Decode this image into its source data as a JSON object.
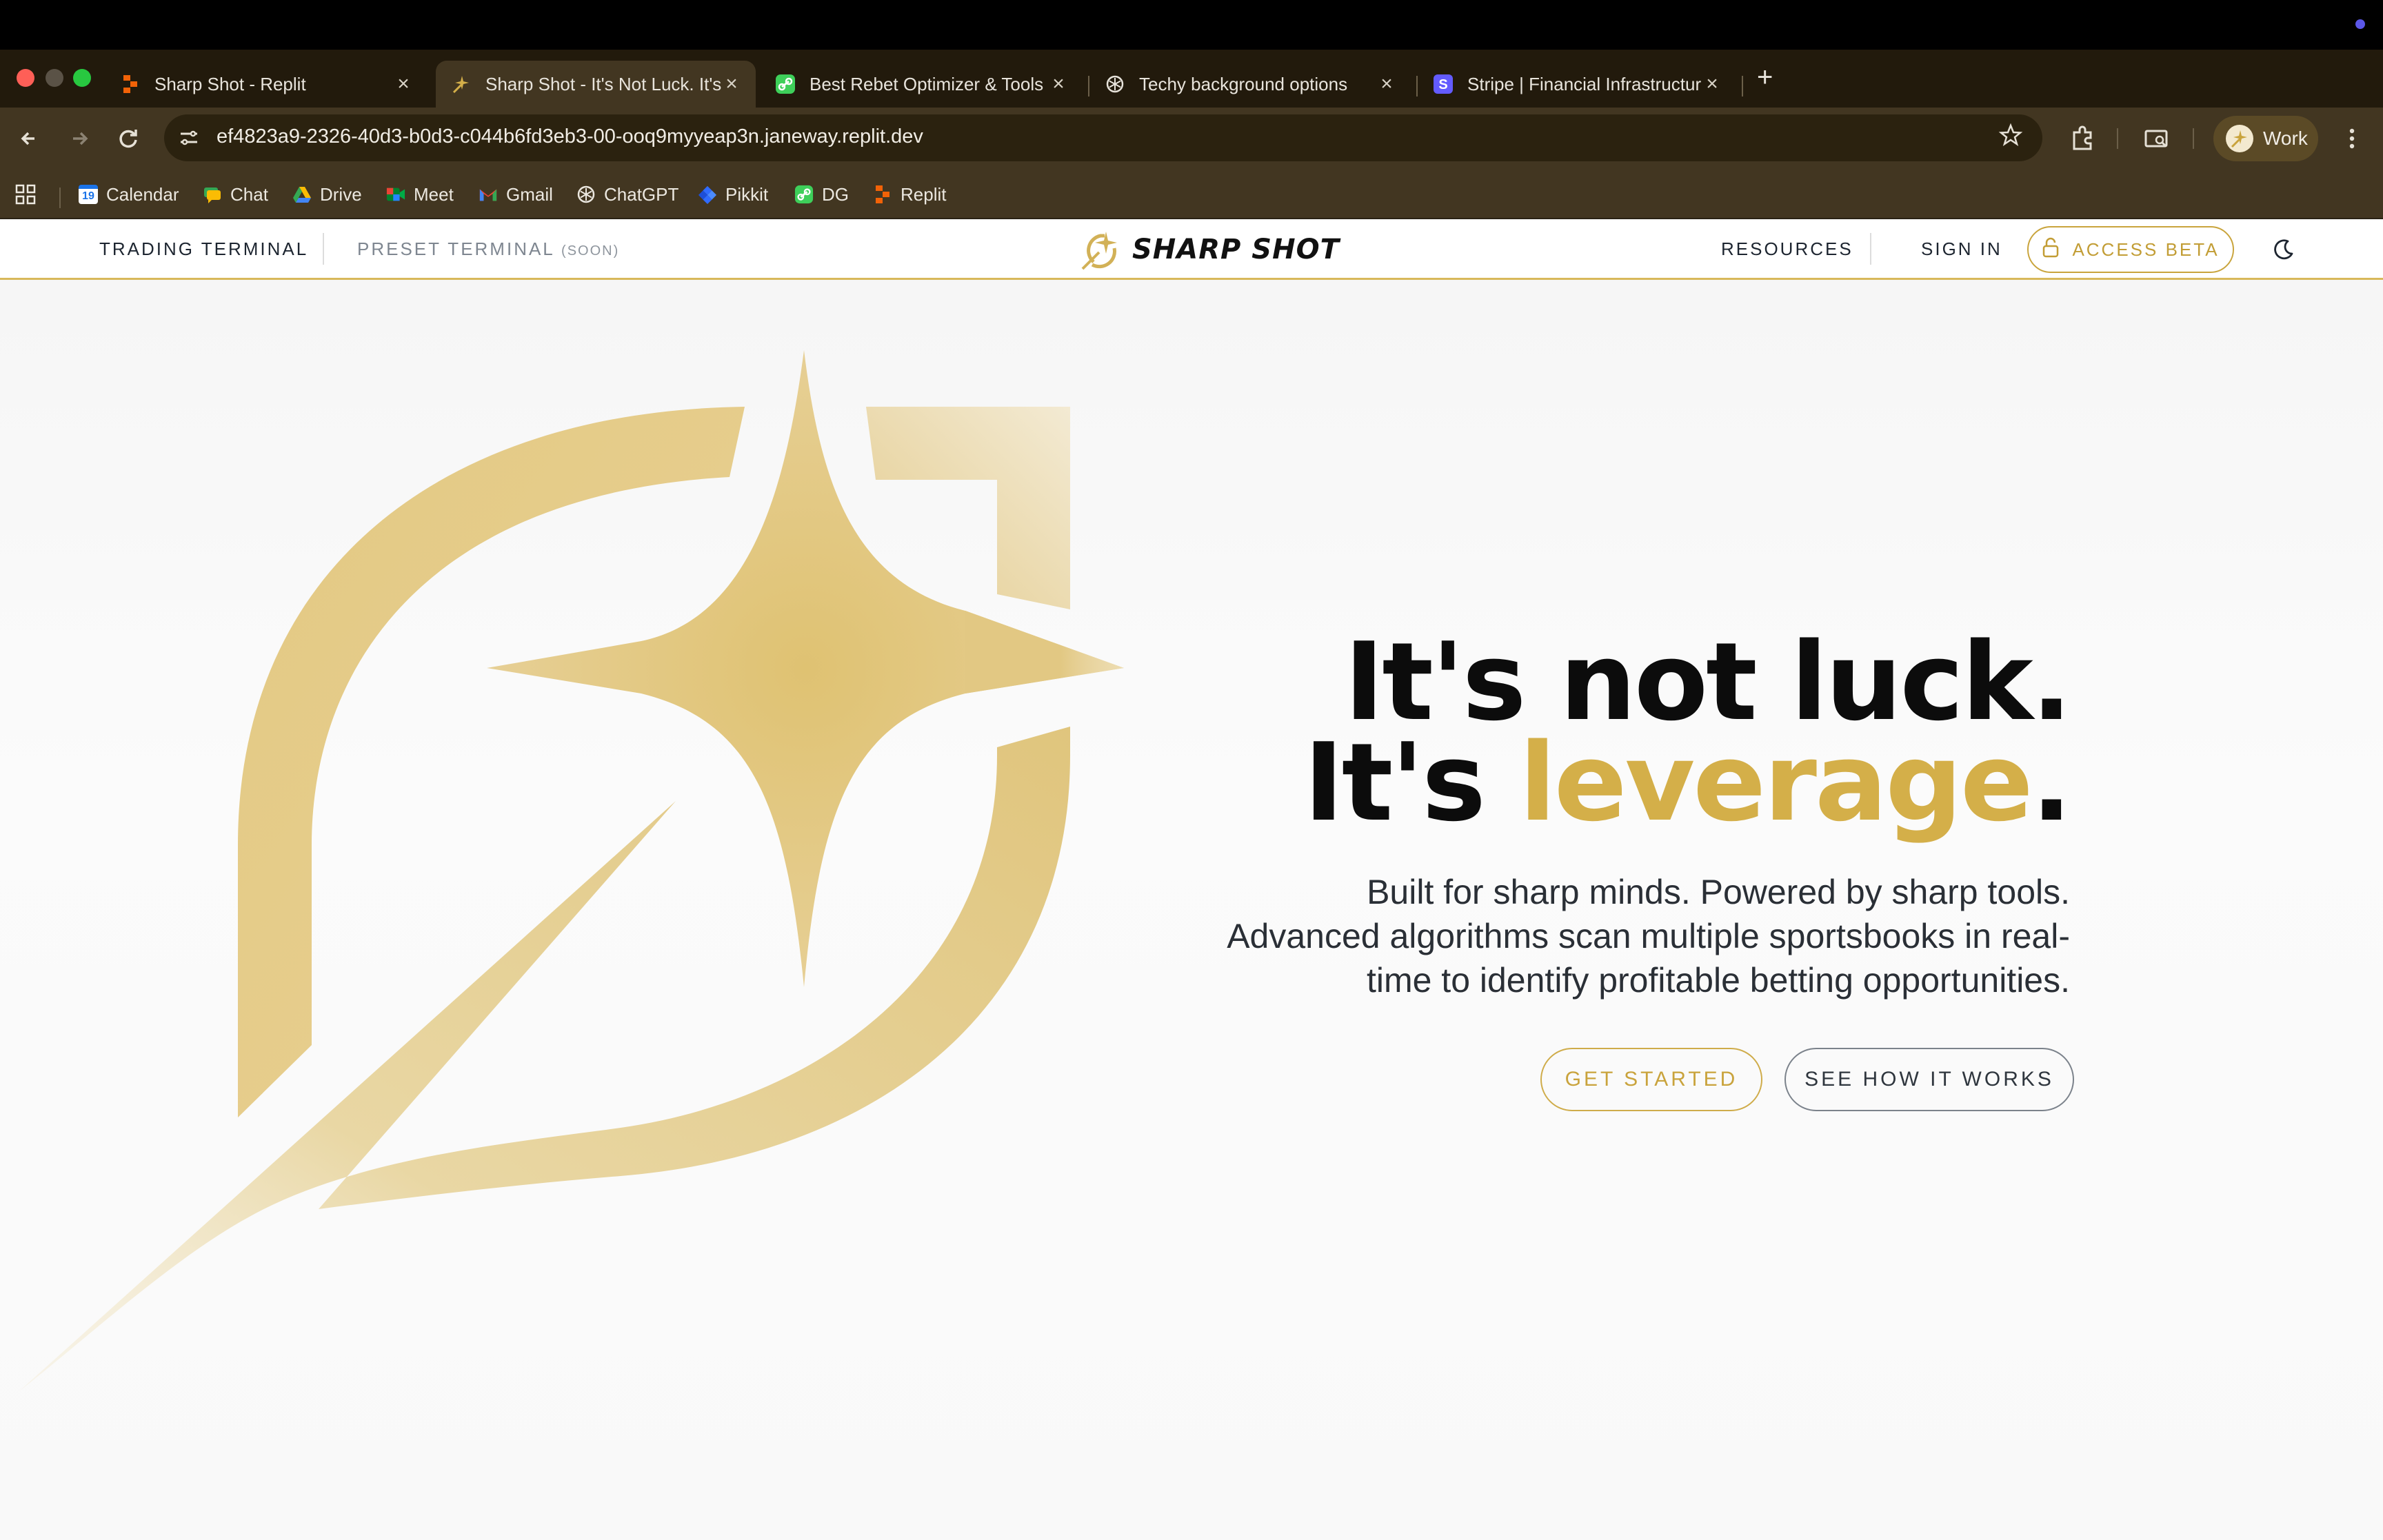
{
  "browser": {
    "tabs": [
      {
        "title": "Sharp Shot - Replit",
        "icon": "replit-icon",
        "active": false
      },
      {
        "title": "Sharp Shot - It's Not Luck. It's Leverage",
        "icon": "sharpshot-icon",
        "active": true
      },
      {
        "title": "Best Rebet Optimizer & Tools",
        "icon": "link-icon",
        "active": false
      },
      {
        "title": "Techy background options",
        "icon": "chatgpt-icon",
        "active": false
      },
      {
        "title": "Stripe | Financial Infrastructure",
        "icon": "stripe-icon",
        "active": false
      }
    ],
    "close_glyph": "×",
    "new_tab_glyph": "+",
    "url": "ef4823a9-2326-40d3-b0d3-c044b6fd3eb3-00-ooq9myyeap3n.janeway.replit.dev",
    "profile_label": "Work",
    "bookmarks": [
      {
        "label": "Calendar",
        "icon": "calendar-icon"
      },
      {
        "label": "Chat",
        "icon": "chat-icon"
      },
      {
        "label": "Drive",
        "icon": "drive-icon"
      },
      {
        "label": "Meet",
        "icon": "meet-icon"
      },
      {
        "label": "Gmail",
        "icon": "gmail-icon"
      },
      {
        "label": "ChatGPT",
        "icon": "chatgpt-icon"
      },
      {
        "label": "Pikkit",
        "icon": "pikkit-icon"
      },
      {
        "label": "DG",
        "icon": "dg-icon"
      },
      {
        "label": "Replit",
        "icon": "replit-icon"
      }
    ],
    "calendar_day": "19"
  },
  "site": {
    "nav_left": {
      "trading": "TRADING TERMINAL",
      "preset": "PRESET TERMINAL",
      "preset_tag": "(SOON)"
    },
    "brand": "SHARP SHOT",
    "nav_right": {
      "resources": "RESOURCES",
      "sign_in": "SIGN IN",
      "access_beta": "ACCESS BETA"
    }
  },
  "hero": {
    "line1": "It's not luck.",
    "line2_prefix": "It's ",
    "line2_highlight": "leverage",
    "line2_suffix": ".",
    "subcopy_line1": "Built for sharp minds. Powered by sharp tools.",
    "subcopy_line2": "Advanced algorithms scan multiple sportsbooks in real-",
    "subcopy_line3": "time to identify profitable betting opportunities.",
    "cta_primary": "GET STARTED",
    "cta_secondary": "SEE HOW IT WORKS"
  },
  "colors": {
    "accent_gold": "#d4af49",
    "chrome_bg": "#423621",
    "tabstrip_bg": "#221a0c"
  }
}
